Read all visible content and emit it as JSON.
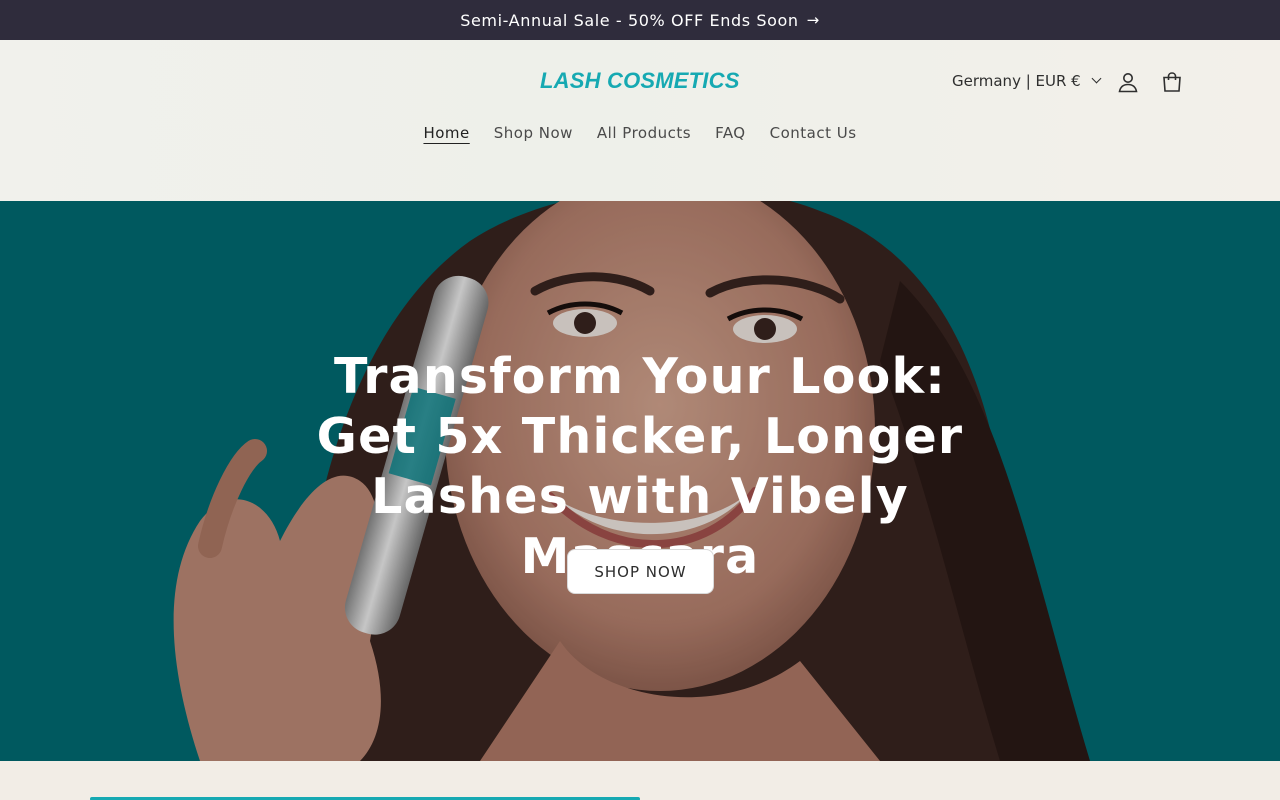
{
  "announcement": {
    "text": "Semi-Annual Sale - 50% OFF Ends Soon",
    "arrow": "→"
  },
  "header": {
    "logo": "LASH COSMETICS",
    "locale": "Germany | EUR €",
    "icons": {
      "account": "account-icon",
      "cart": "cart-icon"
    }
  },
  "nav": {
    "items": [
      {
        "label": "Home",
        "active": true
      },
      {
        "label": "Shop Now"
      },
      {
        "label": "All Products"
      },
      {
        "label": "FAQ"
      },
      {
        "label": "Contact Us"
      }
    ]
  },
  "hero": {
    "title": "Transform Your Look: Get 5x Thicker, Longer Lashes with Vibely Mascara",
    "button": "SHOP NOW"
  },
  "colors": {
    "brand": "#16a9b2",
    "announcement_bg": "#2f2c3c",
    "hero_bg": "#006d74"
  }
}
